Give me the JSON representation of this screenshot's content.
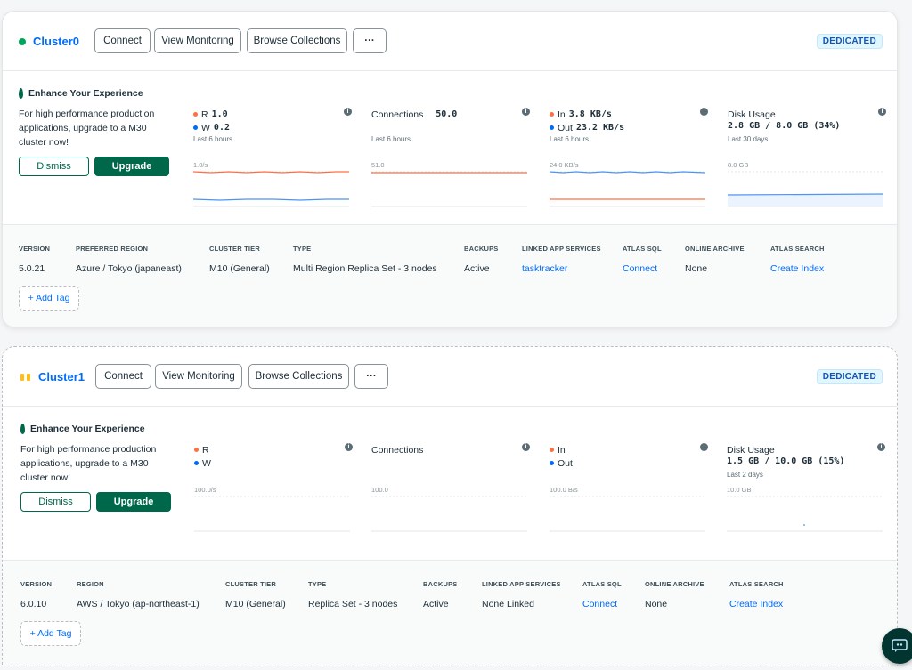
{
  "clusters": [
    {
      "name": "Cluster0",
      "status": "running",
      "buttons": {
        "connect": "Connect",
        "monitoring": "View Monitoring",
        "browse": "Browse Collections",
        "more": "···"
      },
      "badge": "DEDICATED",
      "promo": {
        "title": "Enhance Your Experience",
        "text": "For high performance production applications, upgrade to a M30 cluster now!",
        "dismiss": "Dismiss",
        "upgrade": "Upgrade"
      },
      "metrics": {
        "rw": {
          "r_label": "R",
          "r_value": "1.0",
          "w_label": "W",
          "w_value": "0.2",
          "period": "Last 6 hours",
          "scale": "1.0/s"
        },
        "connections": {
          "label": "Connections",
          "value": "50.0",
          "period": "Last 6 hours",
          "scale": "51.0"
        },
        "network": {
          "in_label": "In",
          "in_value": "3.8 KB/s",
          "out_label": "Out",
          "out_value": "23.2 KB/s",
          "period": "Last 6 hours",
          "scale": "24.0 KB/s"
        },
        "disk": {
          "label": "Disk Usage",
          "value": "2.8 GB / 8.0 GB (34%)",
          "period": "Last 30 days",
          "scale": "8.0 GB"
        }
      },
      "details": [
        {
          "label": "VERSION",
          "value": "5.0.21"
        },
        {
          "label": "PREFERRED REGION",
          "value": "Azure / Tokyo (japaneast)"
        },
        {
          "label": "CLUSTER TIER",
          "value": "M10 (General)"
        },
        {
          "label": "TYPE",
          "value": "Multi Region Replica Set - 3 nodes"
        },
        {
          "label": "BACKUPS",
          "value": "Active"
        },
        {
          "label": "LINKED APP SERVICES",
          "value": "tasktracker"
        },
        {
          "label": "ATLAS SQL",
          "value": "Connect"
        },
        {
          "label": "ONLINE ARCHIVE",
          "value": "None"
        },
        {
          "label": "ATLAS SEARCH",
          "value": "Create Index"
        }
      ],
      "add_tag": "+ Add Tag"
    },
    {
      "name": "Cluster1",
      "status": "paused",
      "buttons": {
        "connect": "Connect",
        "monitoring": "View Monitoring",
        "browse": "Browse Collections",
        "more": "···"
      },
      "badge": "DEDICATED",
      "promo": {
        "title": "Enhance Your Experience",
        "text": "For high performance production applications, upgrade to a M30 cluster now!",
        "dismiss": "Dismiss",
        "upgrade": "Upgrade"
      },
      "metrics": {
        "rw": {
          "r_label": "R",
          "w_label": "W",
          "scale": "100.0/s"
        },
        "connections": {
          "label": "Connections",
          "scale": "100.0"
        },
        "network": {
          "in_label": "In",
          "out_label": "Out",
          "scale": "100.0 B/s"
        },
        "disk": {
          "label": "Disk Usage",
          "value": "1.5 GB / 10.0 GB (15%)",
          "period": "Last 2 days",
          "scale": "10.0 GB"
        }
      },
      "details": [
        {
          "label": "VERSION",
          "value": "6.0.10"
        },
        {
          "label": "REGION",
          "value": "AWS / Tokyo (ap-northeast-1)"
        },
        {
          "label": "CLUSTER TIER",
          "value": "M10 (General)"
        },
        {
          "label": "TYPE",
          "value": "Replica Set - 3 nodes"
        },
        {
          "label": "BACKUPS",
          "value": "Active"
        },
        {
          "label": "LINKED APP SERVICES",
          "value": "None Linked"
        },
        {
          "label": "ATLAS SQL",
          "value": "Connect"
        },
        {
          "label": "ONLINE ARCHIVE",
          "value": "None"
        },
        {
          "label": "ATLAS SEARCH",
          "value": "Create Index"
        }
      ],
      "add_tag": "+ Add Tag"
    }
  ],
  "colors": {
    "primary_link": "#016bf8",
    "brand_green": "#00684a",
    "read_series": "#ff6f44",
    "write_series": "#016bf8"
  },
  "icons": {
    "running": "green-dot-icon",
    "paused": "pause-icon",
    "info": "info-icon",
    "leaf": "leaf-icon",
    "chat": "chat-icon"
  }
}
